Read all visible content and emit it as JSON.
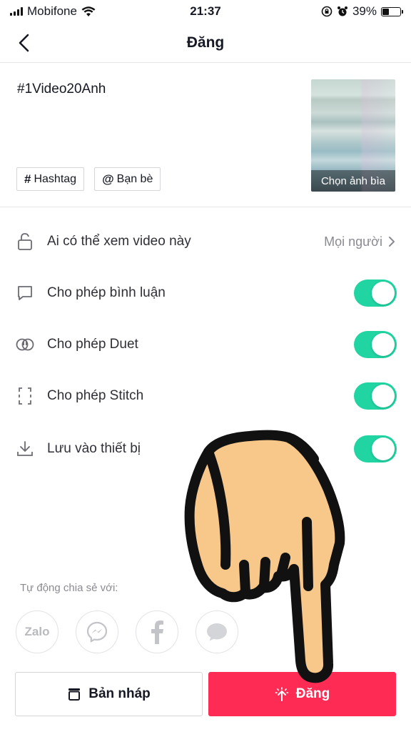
{
  "status_bar": {
    "carrier": "Mobifone",
    "time": "21:37",
    "battery": "39%",
    "battery_level": 0.39
  },
  "header": {
    "title": "Đăng"
  },
  "caption": {
    "text": "#1Video20Anh"
  },
  "chips": {
    "hashtag": "Hashtag",
    "hashtag_icon": "#",
    "mention": "Bạn bè",
    "mention_icon": "@"
  },
  "cover": {
    "label": "Chọn ảnh bìa"
  },
  "settings": {
    "privacy": {
      "label": "Ai có thể xem video này",
      "value": "Mọi người",
      "icon": "unlock-icon"
    },
    "comments": {
      "label": "Cho phép bình luận",
      "enabled": true,
      "icon": "comment-icon"
    },
    "duet": {
      "label": "Cho phép Duet",
      "enabled": true,
      "icon": "duet-icon"
    },
    "stitch": {
      "label": "Cho phép Stitch",
      "enabled": true,
      "icon": "stitch-icon"
    },
    "save": {
      "label": "Lưu vào thiết bị",
      "enabled": true,
      "icon": "download-icon"
    }
  },
  "share": {
    "title": "Tự động chia sẻ với:",
    "targets": [
      "Zalo",
      "Messenger",
      "Facebook",
      "Message"
    ],
    "zalo_label": "Zalo"
  },
  "actions": {
    "draft": "Bản nháp",
    "post": "Đăng"
  },
  "colors": {
    "accent": "#fe2c55",
    "toggle_on": "#20d5a2"
  }
}
